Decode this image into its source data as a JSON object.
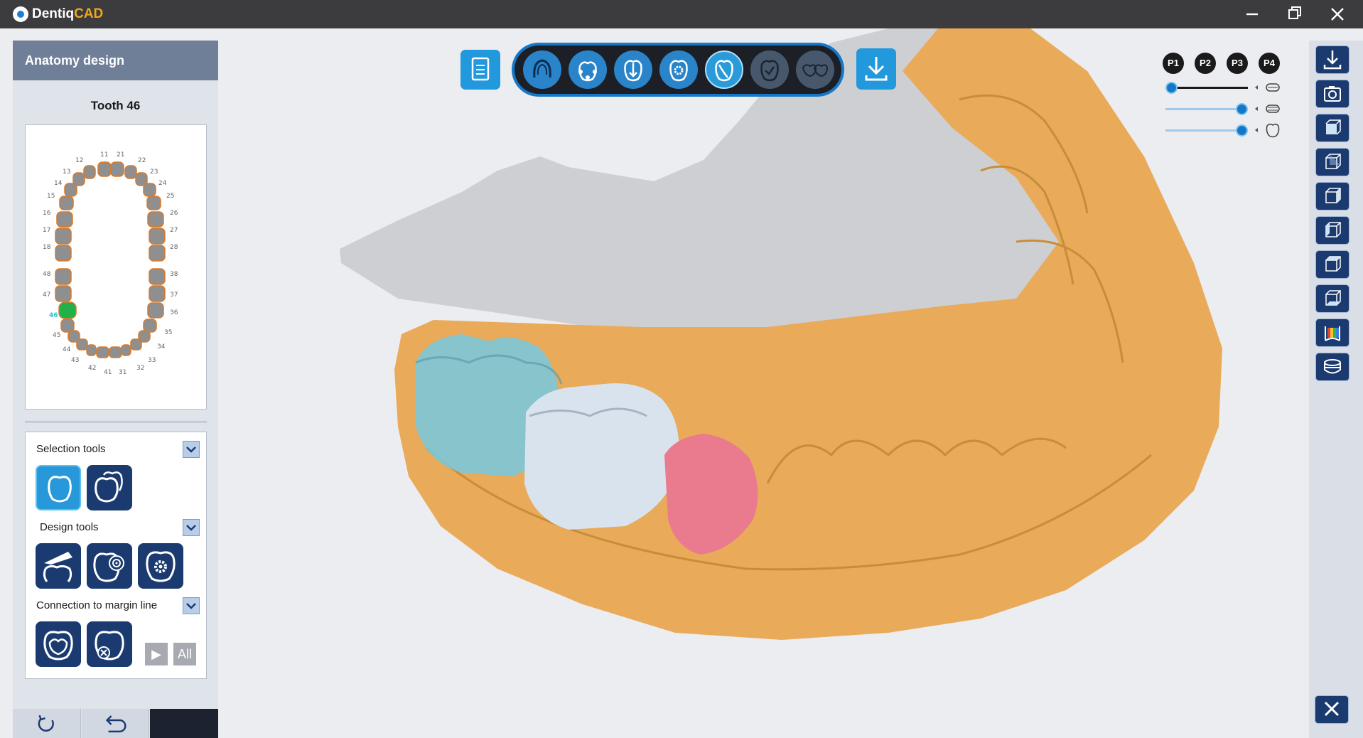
{
  "app": {
    "name_part1": "Dentiq",
    "name_part2": "CAD",
    "window_controls": [
      "minimize-icon",
      "restore-icon",
      "close-icon"
    ]
  },
  "left_panel": {
    "header": "Anatomy design",
    "tooth_title": "Tooth 46",
    "tooth_chart": {
      "selected_tooth": "46",
      "upper_labels": [
        "11",
        "12",
        "13",
        "14",
        "15",
        "16",
        "17",
        "18",
        "21",
        "22",
        "23",
        "24",
        "25",
        "26",
        "27",
        "28"
      ],
      "lower_labels": [
        "31",
        "32",
        "33",
        "35",
        "36",
        "37",
        "38",
        "41",
        "42",
        "43",
        "44",
        "45",
        "46",
        "47",
        "48"
      ],
      "colors": {
        "tooth": "#8f8f8f",
        "outline": "#d97a2a",
        "selected": "#22b04a",
        "selected_label": "#2bbfd0"
      }
    },
    "sections": [
      {
        "label": "Selection tools",
        "tools": [
          "tooth-select-icon",
          "multi-tooth-select-icon"
        ]
      },
      {
        "label": "Design tools",
        "tools": [
          "cut-tool-icon",
          "target-tool-icon",
          "gear-tooth-icon"
        ]
      },
      {
        "label": "Connection to margin line",
        "tools": [
          "connect-margin-icon",
          "disconnect-margin-icon"
        ],
        "play_label": "▶",
        "all_label": "All"
      }
    ],
    "bottom": {
      "reset": "reset-icon",
      "undo": "undo-icon"
    }
  },
  "workflow_toolbar": {
    "doc_icon": "document-icon",
    "steps": [
      "arch-step-icon",
      "margin-step-icon",
      "insertion-step-icon",
      "settings-step-icon",
      "anatomy-step-icon",
      "check-step-icon",
      "finish-step-icon"
    ],
    "active_step": 4,
    "download_icon": "download-icon"
  },
  "view_controls": {
    "p_buttons": [
      "P1",
      "P2",
      "P3",
      "P4"
    ],
    "sliders": [
      {
        "name": "upper-jaw-opacity",
        "value": 0.05
      },
      {
        "name": "lower-jaw-opacity",
        "value": 1.0
      },
      {
        "name": "tooth-opacity",
        "value": 1.0
      }
    ]
  },
  "right_rail": {
    "buttons": [
      "export-icon",
      "camera-icon",
      "view-front-icon",
      "view-back-icon",
      "view-left-icon",
      "view-right-icon",
      "view-top-icon",
      "view-bottom-icon",
      "color-map-icon",
      "jaw-icon"
    ],
    "close": "close-icon"
  },
  "colors": {
    "accent": "#2298dd",
    "dark_button": "#1b3b70",
    "model": "#e9aa5a",
    "crown_cyan": "#7cc6d8",
    "crown_white": "#d9e3ee",
    "crown_pink": "#ea7a8d"
  }
}
